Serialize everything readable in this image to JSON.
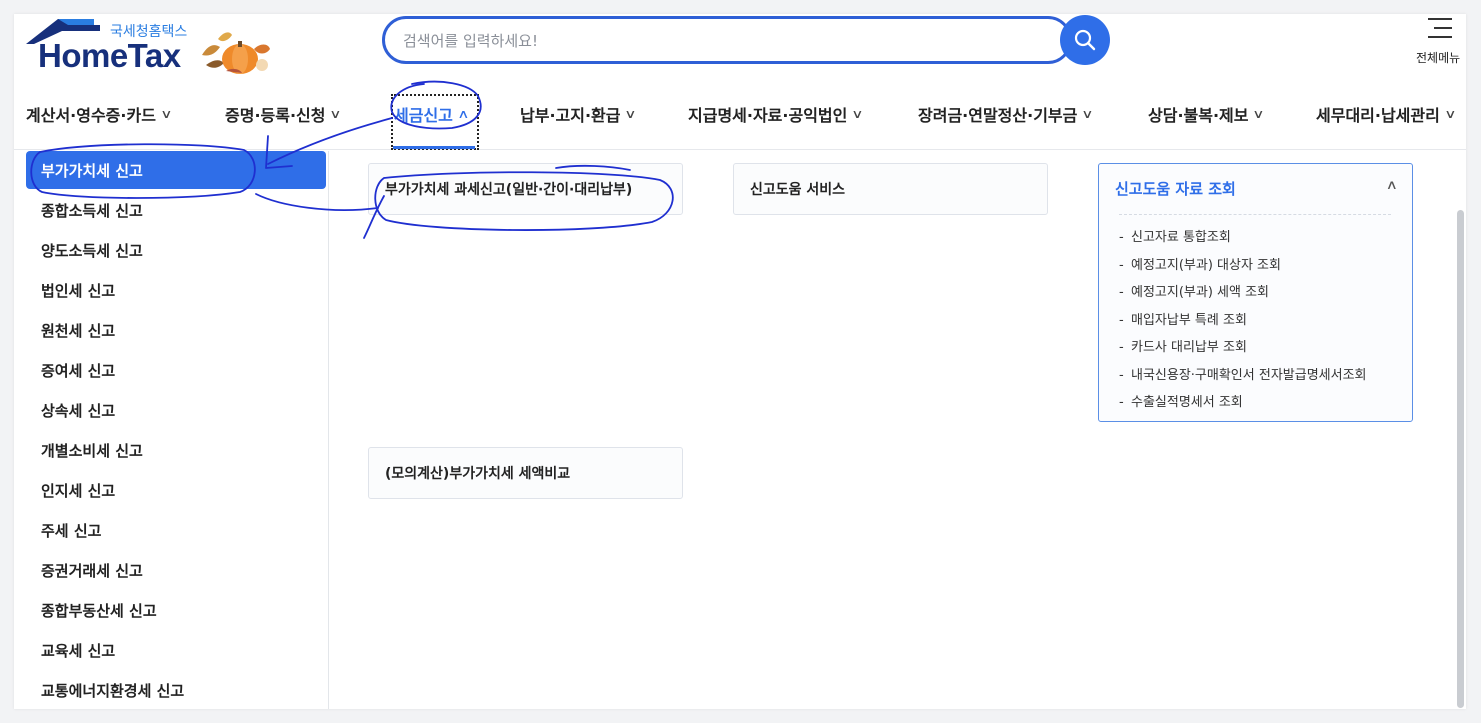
{
  "brand": {
    "sub_name": "국세청홈택스",
    "name": "HomeTax"
  },
  "search": {
    "placeholder": "검색어를 입력하세요!"
  },
  "header": {
    "all_menu_label": "전체메뉴"
  },
  "gnb": [
    {
      "label": "계산서·영수증·카드"
    },
    {
      "label": "증명·등록·신청"
    },
    {
      "label": "세금신고",
      "active": true
    },
    {
      "label": "납부·고지·환급"
    },
    {
      "label": "지급명세·자료·공익법인"
    },
    {
      "label": "장려금·연말정산·기부금"
    },
    {
      "label": "상담·불복·제보"
    },
    {
      "label": "세무대리·납세관리"
    }
  ],
  "lnb": [
    {
      "label": "부가가치세 신고",
      "active": true
    },
    {
      "label": "종합소득세 신고"
    },
    {
      "label": "양도소득세 신고"
    },
    {
      "label": "법인세 신고"
    },
    {
      "label": "원천세 신고"
    },
    {
      "label": "증여세 신고"
    },
    {
      "label": "상속세 신고"
    },
    {
      "label": "개별소비세 신고"
    },
    {
      "label": "인지세 신고"
    },
    {
      "label": "주세 신고"
    },
    {
      "label": "증권거래세 신고"
    },
    {
      "label": "종합부동산세 신고"
    },
    {
      "label": "교육세 신고"
    },
    {
      "label": "교통에너지환경세 신고"
    }
  ],
  "content": {
    "cards": [
      {
        "label": "부가가치세 과세신고(일반·간이·대리납부)"
      },
      {
        "label": "신고도움 서비스"
      },
      {
        "label": "(모의계산)부가가치세 세액비교"
      }
    ],
    "panel": {
      "title": "신고도움 자료 조회",
      "links": [
        "신고자료 통합조회",
        "예정고지(부과) 대상자 조회",
        "예정고지(부과) 세액 조회",
        "매입자납부 특례 조회",
        "카드사 대리납부 조회",
        "내국신용장·구매확인서 전자발급명세서조회",
        "수출실적명세서 조회"
      ]
    }
  },
  "colors": {
    "accent": "#2f6ee8",
    "brand_navy": "#17307c",
    "annotation_ink": "#1f2fd0"
  },
  "icons": {
    "search": "search-icon",
    "menu": "hamburger-icon",
    "dropdown": "chevron-down-icon",
    "collapse": "chevron-up-icon",
    "logo_decoration": "pumpkin-decoration-icon"
  }
}
